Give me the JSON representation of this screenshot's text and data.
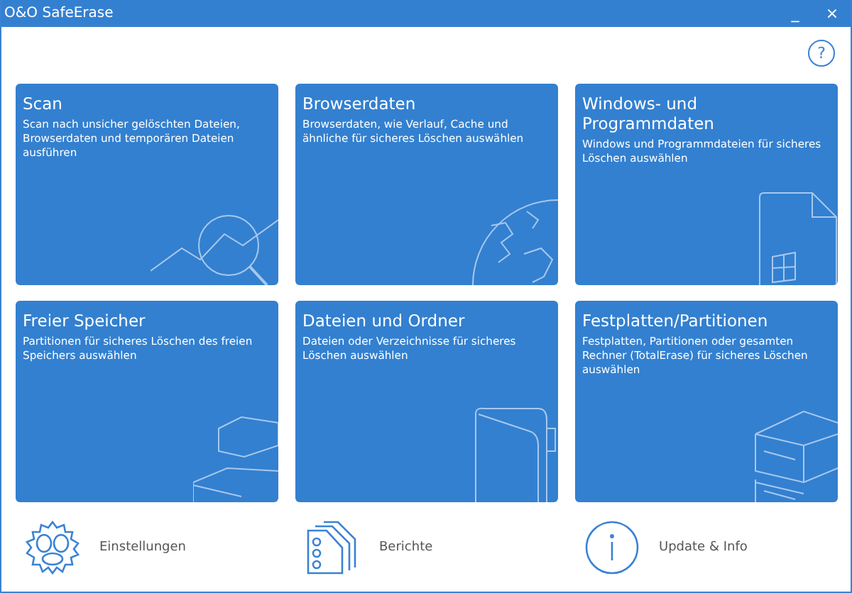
{
  "window": {
    "title": "O&O SafeErase",
    "controls": [
      "_",
      "×"
    ]
  },
  "help": "?",
  "tiles": [
    {
      "kind": "scan",
      "title": "Scan",
      "description": "Scan nach unsicher gelöschten Dateien, Browserdaten und temporären Dateien ausführen"
    },
    {
      "kind": "browser",
      "title": "Browserdaten",
      "description": "Browserdaten, wie Verlauf, Cache und ähnliche für sicheres Löschen auswählen"
    },
    {
      "kind": "windows",
      "title": "Windows- und Programmdaten",
      "description": "Windows und Programmdateien für sicheres Löschen auswählen"
    },
    {
      "kind": "space",
      "title": "Freier Speicher",
      "description": "Partitionen für sicheres Löschen des freien Speichers auswählen"
    },
    {
      "kind": "files",
      "title": "Dateien und Ordner",
      "description": "Dateien oder Verzeichnisse für sicheres Löschen auswählen"
    },
    {
      "kind": "disks",
      "title": "Festplatten/Partitionen",
      "description": "Festplatten, Partitionen oder gesamten Rechner (TotalErase) für sicheres Löschen auswählen"
    }
  ],
  "footer": [
    {
      "kind": "settings",
      "label": "Einstellungen"
    },
    {
      "kind": "reports",
      "label": "Berichte"
    },
    {
      "kind": "info",
      "label": "Update & Info"
    }
  ]
}
